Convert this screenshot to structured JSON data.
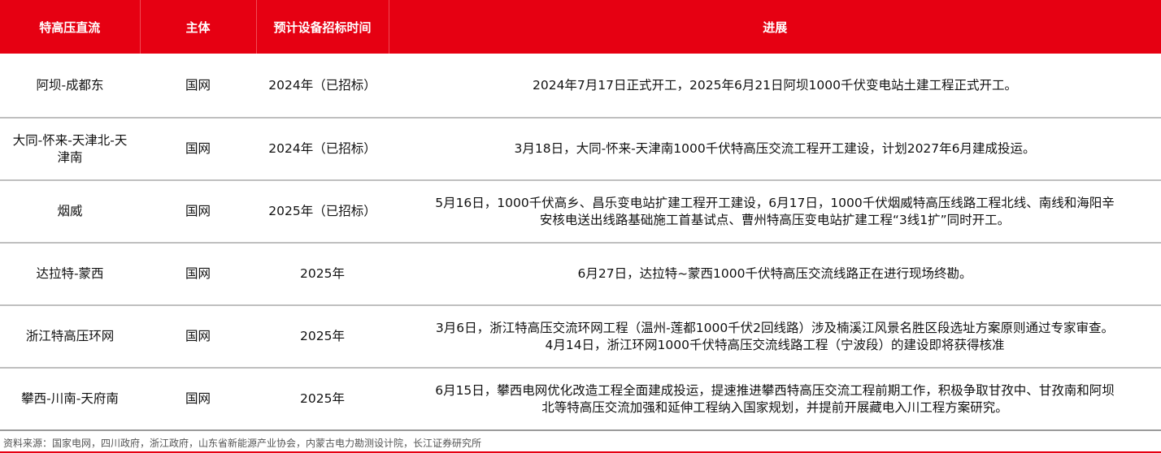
{
  "table": {
    "headers": [
      "特高压直流",
      "主体",
      "预计设备招标时间",
      "进展"
    ],
    "rows": [
      {
        "project": "阿坝-成都东",
        "owner": "国网",
        "tender": "2024年（已招标）",
        "progress": [
          "2024年7月17日正式开工，2025年6月21日阿坝1000千伏变电站土建工程正式开工。"
        ]
      },
      {
        "project": "大同-怀来-天津北-天",
        "project2": "津南",
        "owner": "国网",
        "tender": "2024年（已招标）",
        "progress": [
          "3月18日，大同-怀来-天津南1000千伏特高压交流工程开工建设，计划2027年6月建成投运。"
        ]
      },
      {
        "project": "烟威",
        "owner": "国网",
        "tender": "2025年（已招标）",
        "progress": [
          "5月16日，1000千伏高乡、昌乐变电站扩建工程开工建设，6月17日，1000千伏烟威特高压线路工程北线、南线和海阳辛",
          "安核电送出线路基础施工首基试点、曹州特高压变电站扩建工程“3线1扩”同时开工。"
        ]
      },
      {
        "project": "达拉特-蒙西",
        "owner": "国网",
        "tender": "2025年",
        "progress": [
          "6月27日，达拉特~蒙西1000千伏特高压交流线路正在进行现场终勘。"
        ]
      },
      {
        "project": "浙江特高压环网",
        "owner": "国网",
        "tender": "2025年",
        "progress": [
          "3月6日，浙江特高压交流环网工程（温州-莲都1000千伏2回线路）涉及楠溪江风景名胜区段选址方案原则通过专家审查。",
          "4月14日，浙江环网1000千伏特高压交流线路工程（宁波段）的建设即将获得核准"
        ]
      },
      {
        "project": "攀西-川南-天府南",
        "owner": "国网",
        "tender": "2025年",
        "progress": [
          "6月15日，攀西电网优化改造工程全面建成投运，提速推进攀西特高压交流工程前期工作，积极争取甘孜中、甘孜南和阿坝",
          "北等特高压交流加强和延伸工程纳入国家规划，并提前开展藏电入川工程方案研究。"
        ]
      }
    ]
  },
  "source_note": "资料来源：国家电网，四川政府，浙江政府，山东省新能源产业协会，内蒙古电力勘测设计院，长江证券研究所",
  "colors": {
    "header_bg": "#e60012",
    "header_text": "#ffffff",
    "row_divider": "#bfbfbf"
  }
}
